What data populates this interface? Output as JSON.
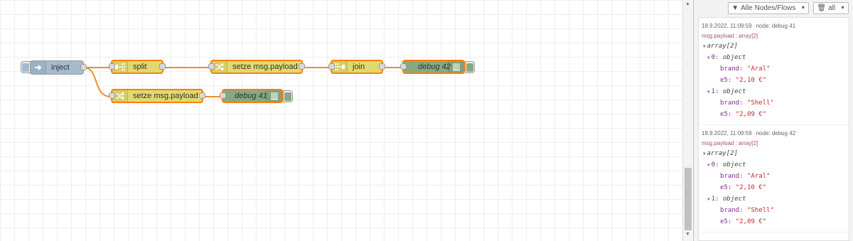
{
  "flow": {
    "nodes": {
      "inject": {
        "label": "inject",
        "color": "#a6bbcf"
      },
      "split": {
        "label": "split",
        "color": "#e2d96e"
      },
      "change1": {
        "label": "setze msg.payload",
        "color": "#e2d96e"
      },
      "join": {
        "label": "join",
        "color": "#e2d96e"
      },
      "debug42": {
        "label": "debug 42",
        "color": "#87a980"
      },
      "change2": {
        "label": "setze msg.payload",
        "color": "#e2d96e"
      },
      "debug41": {
        "label": "debug 41",
        "color": "#87a980"
      }
    },
    "wire_color": "#f28d24"
  },
  "sidebar": {
    "filter_label": "Alle Nodes/Flows",
    "clear_label": "all",
    "messages": [
      {
        "timestamp": "18.9.2022, 11:09:59",
        "node": "node: debug 41",
        "topic": "msg.payload : array[2]",
        "rows": [
          {
            "indent": 0,
            "type": "array[2]"
          },
          {
            "indent": 1,
            "key": "0:",
            "type": "object"
          },
          {
            "indent": 2,
            "key": "brand:",
            "val": "\"Aral\""
          },
          {
            "indent": 2,
            "key": "e5:",
            "val": "\"2,10 €\""
          },
          {
            "indent": 1,
            "key": "1:",
            "type": "object"
          },
          {
            "indent": 2,
            "key": "brand:",
            "val": "\"Shell\""
          },
          {
            "indent": 2,
            "key": "e5:",
            "val": "\"2,09 €\""
          }
        ]
      },
      {
        "timestamp": "18.9.2022, 11:09:59",
        "node": "node: debug 42",
        "topic": "msg.payload : array[2]",
        "rows": [
          {
            "indent": 0,
            "type": "array[2]"
          },
          {
            "indent": 1,
            "key": "0:",
            "type": "object"
          },
          {
            "indent": 2,
            "key": "brand:",
            "val": "\"Aral\""
          },
          {
            "indent": 2,
            "key": "e5:",
            "val": "\"2,10 €\""
          },
          {
            "indent": 1,
            "key": "1:",
            "type": "object"
          },
          {
            "indent": 2,
            "key": "brand:",
            "val": "\"Shell\""
          },
          {
            "indent": 2,
            "key": "e5:",
            "val": "\"2,09 €\""
          }
        ]
      }
    ]
  }
}
